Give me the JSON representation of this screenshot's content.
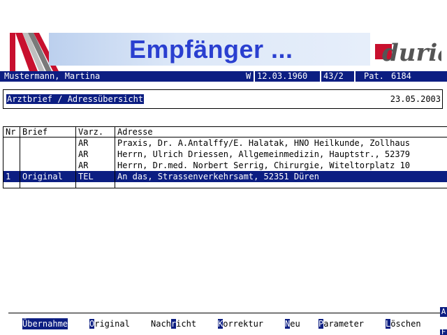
{
  "header": {
    "title": "Empfänger ...",
    "logo_text": "duria"
  },
  "patient": {
    "name": "Mustermann, Martina",
    "sex": "W",
    "birthdate": "12.03.1960",
    "code": "43/2",
    "pat_label": "Pat.",
    "pat_number": "6184"
  },
  "subheader": {
    "title": "Arztbrief / Adressübersicht",
    "date": "23.05.2003"
  },
  "table": {
    "columns": [
      "Nr",
      "Brief",
      "Varz.",
      "Adresse"
    ],
    "rows": [
      {
        "nr": "",
        "brief": "",
        "varz": "AR",
        "adresse": "Praxis, Dr. A.Antalffy/E. Halatak, HNO Heilkunde, Zollhaus"
      },
      {
        "nr": "",
        "brief": "",
        "varz": "AR",
        "adresse": "Herrn, Ulrich Driessen, Allgemeinmedizin, Hauptstr., 52379"
      },
      {
        "nr": "",
        "brief": "",
        "varz": "AR",
        "adresse": "Herrn, Dr.med. Norbert Serrig, Chirurgie, Witeltorplatz 10"
      },
      {
        "nr": "1",
        "brief": "Original",
        "varz": "TEL",
        "adresse": "An das, Strassenverkehrsamt, 52351 Düren"
      }
    ]
  },
  "menu": {
    "items": [
      {
        "label": "Übernahme",
        "selected": true
      },
      {
        "pre": "",
        "key": "O",
        "post": "riginal"
      },
      {
        "pre": "Nach",
        "key": "r",
        "post": "icht"
      },
      {
        "pre": "",
        "key": "K",
        "post": "orrektur"
      },
      {
        "pre": "",
        "key": "N",
        "post": "eu"
      },
      {
        "pre": "",
        "key": "P",
        "post": "arameter"
      },
      {
        "pre": "",
        "key": "L",
        "post": "öschen"
      }
    ]
  },
  "side_marks": [
    "A",
    "F"
  ],
  "colors": {
    "bar": "#0c1e82",
    "title": "#2a3fd0",
    "logo_red": "#c8102e",
    "logo_gray": "#555555"
  }
}
